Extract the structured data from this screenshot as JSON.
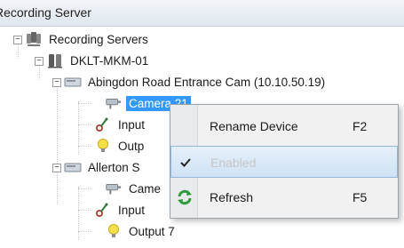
{
  "panel": {
    "title": "Recording Server"
  },
  "tree": {
    "root_label": "Recording Servers",
    "server_label": "DKLT-MKM-01",
    "devices": [
      {
        "label": "Abingdon Road Entrance Cam (10.10.50.19)",
        "children": [
          "Camera 21",
          "Input",
          "Outp"
        ]
      },
      {
        "label": "Allerton S",
        "children": [
          "Came",
          "Input",
          "Output 7"
        ]
      }
    ]
  },
  "context_menu": {
    "items": [
      {
        "label": "Rename Device",
        "shortcut": "F2",
        "icon": "",
        "state": "normal"
      },
      {
        "label": "Enabled",
        "shortcut": "",
        "icon": "checkmark-icon",
        "state": "disabled-highlighted"
      },
      {
        "label": "Refresh",
        "shortcut": "F5",
        "icon": "refresh-icon",
        "state": "normal"
      }
    ]
  },
  "colors": {
    "selection": "#3399ff",
    "menu_highlight": "#cfe2f5"
  }
}
